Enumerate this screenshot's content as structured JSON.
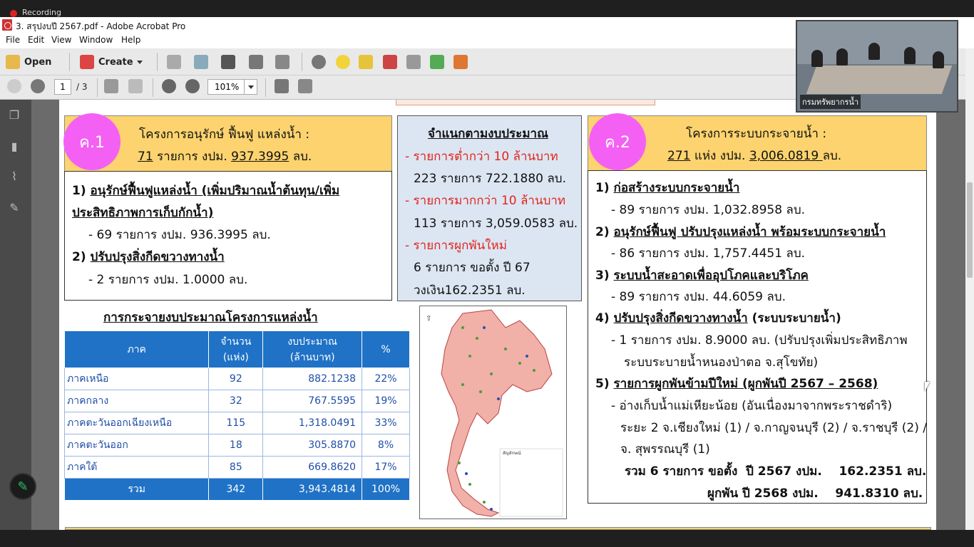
{
  "recording": {
    "label": "Recording"
  },
  "window": {
    "title": "3. สรุปงบปี 2567.pdf - Adobe Acrobat Pro"
  },
  "menu": [
    "File",
    "Edit",
    "View",
    "Window",
    "Help"
  ],
  "toolbar": {
    "open_label": "Open",
    "create_label": "Create"
  },
  "nav": {
    "current_page": "1",
    "total_pages": "/ 3",
    "zoom": "101%"
  },
  "webcam": {
    "caption": "กรมทรัพยากรน้ำ"
  },
  "k1": {
    "badge": "ค.1",
    "title": "โครงการอนุรักษ์ ฟื้นฟู แหล่งน้ำ :",
    "count": "71",
    "count_suffix": " รายการ งปม.  ",
    "budget": "937.3995",
    "budget_suffix": " ลบ.",
    "item1_num": "1) ",
    "item1_title_a": "อนุรักษ์ฟื้นฟูแหล่งน้ำ (เพิ่มปริมาณน้ำต้นทุน/เพิ่ม",
    "item1_title_b": "ประสิทธิภาพการเก็บกักน้ำ)",
    "item1_detail": "- 69 รายการ งปม. 936.3995 ลบ.",
    "item2_num": "2) ",
    "item2_title": "ปรับปรุงสิ่งกีดขวางทางน้ำ",
    "item2_detail": "- 2 รายการ งปม. 1.0000 ลบ."
  },
  "classify": {
    "title": "จำแนกตามงบประมาณ",
    "line1": "- รายการต่ำกว่า 10 ล้านบาท",
    "line1_detail": "223 รายการ 722.1880 ลบ.",
    "line2": "- รายการมากกว่า 10 ล้านบาท",
    "line2_detail": "113 รายการ 3,059.0583 ลบ.",
    "line3": "- รายการผูกพันใหม่",
    "line3_detail_a": "6 รายการ ขอตั้ง ปี 67",
    "line3_detail_b": "วงเงิน162.2351 ลบ."
  },
  "k2": {
    "badge": "ค.2",
    "title": "โครงการระบบกระจายน้ำ :",
    "count": "271",
    "count_suffix": " แห่ง  งปม. ",
    "budget": "3,006.0819 ",
    "budget_suffix": "ลบ.",
    "items": [
      {
        "num": "1) ",
        "title": "ก่อสร้างระบบกระจายน้ำ",
        "detail": "- 89 รายการ งปม. 1,032.8958 ลบ."
      },
      {
        "num": "2) ",
        "title": "อนุรักษ์ฟื้นฟู ปรับปรุงแหล่งน้ำ พร้อมระบบกระจายน้ำ",
        "detail": "- 86 รายการ งปม. 1,757.4451 ลบ."
      },
      {
        "num": "3) ",
        "title": "ระบบน้ำสะอาดเพื่ออุปโภคและบริโภค",
        "detail": "- 89 รายการ งปม. 44.6059 ลบ."
      },
      {
        "num": "4) ",
        "title": "ปรับปรุงสิ่งกีดขวางทางน้ำ",
        "title_suffix": " (ระบบระบายน้ำ)",
        "detail": "- 1 รายการ งปม. 8.9000 ลบ. (ปรับปรุงเพิ่มประสิทธิภาพ",
        "detail2": "ระบบระบายน้ำหนองป่าตอ จ.สุโขทัย)"
      },
      {
        "num": "5) ",
        "title": "รายการผูกพันข้ามปีใหม่ (ผูกพันปี 2567 – 2568)",
        "detail": "- อ่างเก็บน้ำแม่เหียะน้อย (อันเนื่องมาจากพระราชดำริ)",
        "detail2": "ระยะ 2 จ.เชียงใหม่ (1) / จ.กาญจนบุรี (2) / จ.ราชบุรี (2) /",
        "detail3": "จ. สุพรรณบุรี (1)"
      }
    ],
    "sum1": "รวม 6 รายการ ขอตั้ง  ปี 2567 งปม.    162.2351 ลบ.",
    "sum2": "ผูกพัน ปี 2568 งปม.    941.8310 ลบ."
  },
  "table": {
    "title": "การกระจายงบประมาณโครงการแหล่งน้ำ",
    "headers": {
      "region": "ภาค",
      "count_a": "จำนวน",
      "count_b": "(แห่ง)",
      "budget_a": "งบประมาณ",
      "budget_b": "(ล้านบาท)",
      "pct": "%"
    },
    "rows": [
      {
        "region": "ภาคเหนือ",
        "count": "92",
        "budget": "882.1238",
        "pct": "22%"
      },
      {
        "region": "ภาคกลาง",
        "count": "32",
        "budget": "767.5595",
        "pct": "19%"
      },
      {
        "region": "ภาคตะวันออกเฉียงเหนือ",
        "count": "115",
        "budget": "1,318.0491",
        "pct": "33%"
      },
      {
        "region": "ภาคตะวันออก",
        "count": "18",
        "budget": "305.8870",
        "pct": "8%"
      },
      {
        "region": "ภาคใต้",
        "count": "85",
        "budget": "669.8620",
        "pct": "17%"
      }
    ],
    "total": {
      "region": "รวม",
      "count": "342",
      "budget": "3,943.4814",
      "pct": "100%"
    }
  },
  "map": {
    "legend_title": "สัญลักษณ์"
  },
  "colors": {
    "yellow": "#fcd36e",
    "pink": "#f460f4",
    "blue": "#1f72c6",
    "red": "#e2241b",
    "lightblue": "#dce6f3"
  }
}
